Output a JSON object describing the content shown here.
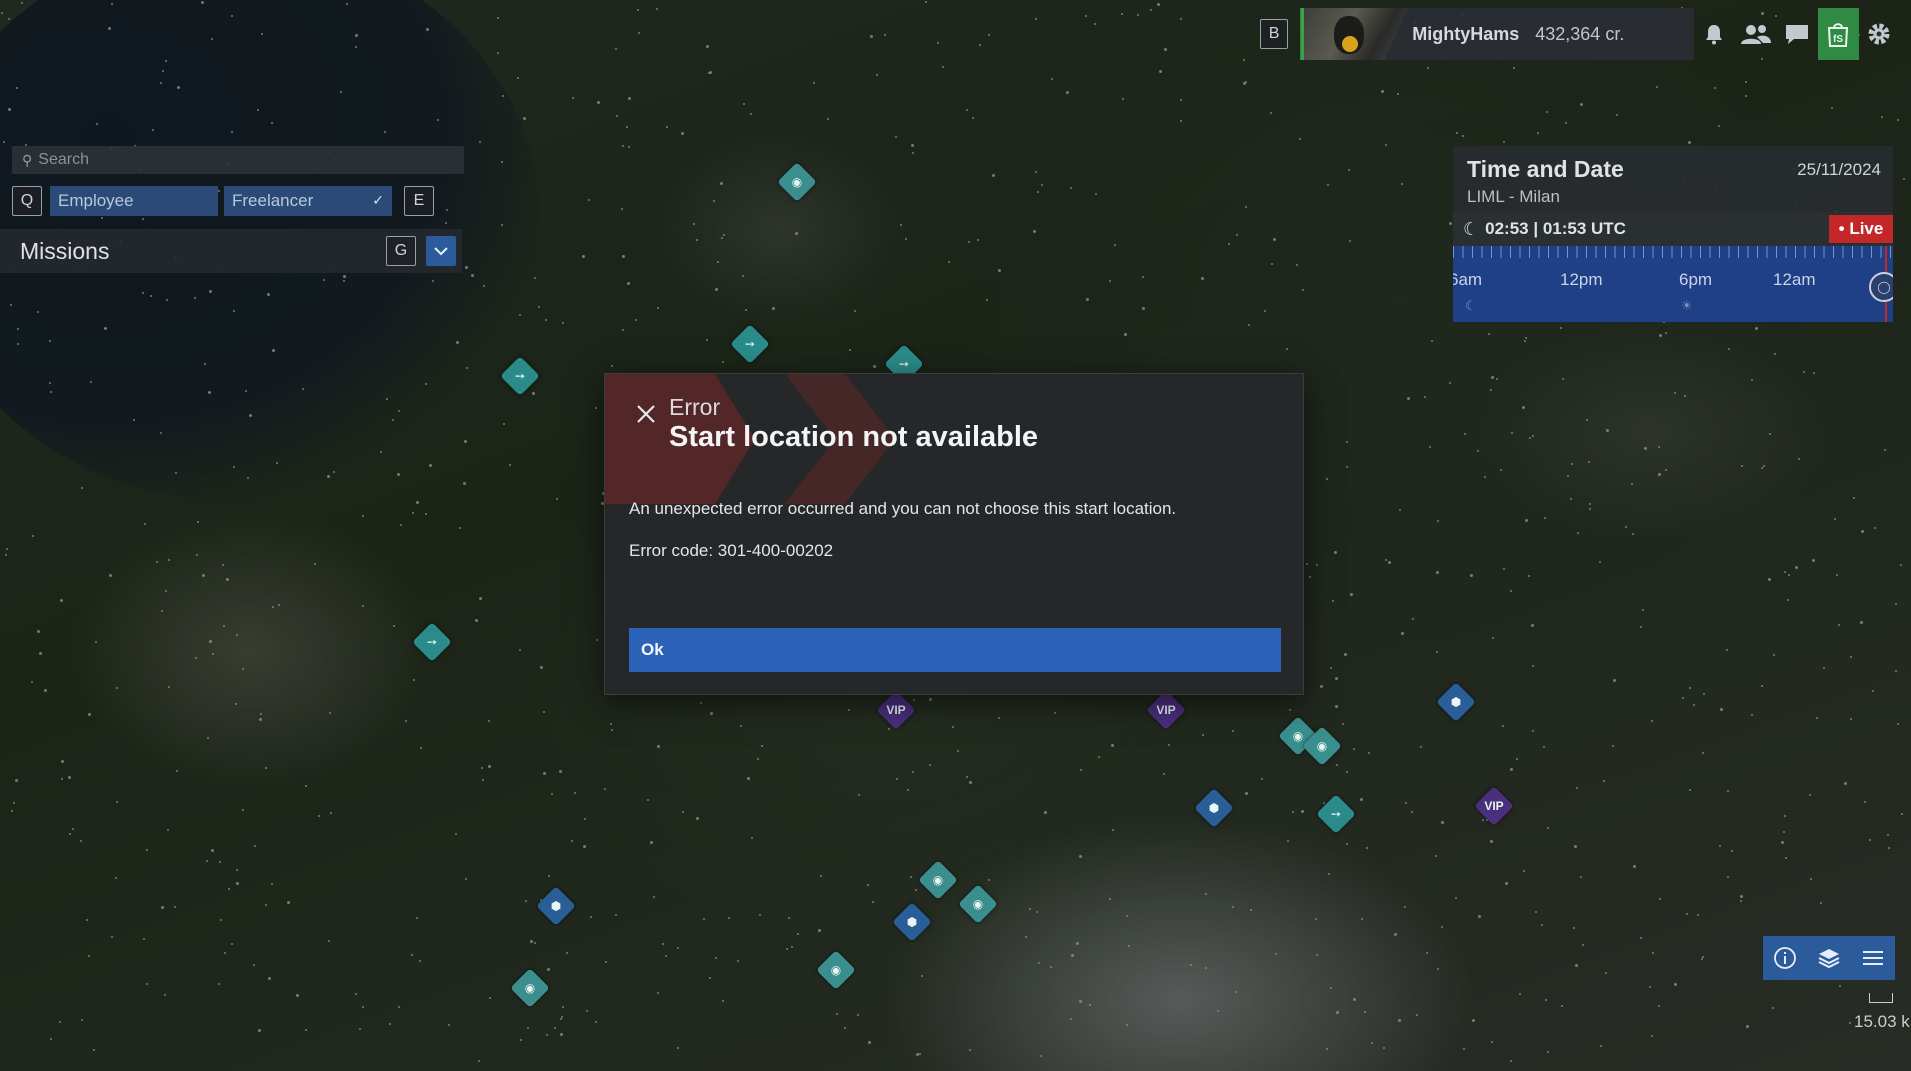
{
  "search": {
    "placeholder": "Search"
  },
  "roles": {
    "prev_key": "Q",
    "next_key": "E",
    "tabs": [
      {
        "label": "Employee",
        "selected": false
      },
      {
        "label": "Freelancer",
        "selected": true
      }
    ]
  },
  "missions": {
    "title": "Missions",
    "toggle_key": "G"
  },
  "topbar": {
    "hotkey": "B",
    "username": "MightyHams",
    "credits": "432,364 cr.",
    "icons": [
      "bell-icon",
      "users-icon",
      "chat-icon",
      "shop-icon",
      "gear-icon"
    ],
    "accent_color": "#2f8a44"
  },
  "time_panel": {
    "title": "Time and Date",
    "date": "25/11/2024",
    "location": "LIML - Milan",
    "current_time": "02:53 | 01:53 UTC",
    "live_label": "• Live",
    "timeline_labels": [
      "6am",
      "12pm",
      "6pm",
      "12am"
    ],
    "live_color": "#c3272a"
  },
  "map": {
    "marker_labels": {
      "vip": "VIP"
    },
    "scale": "15.03 k"
  },
  "dialog": {
    "kicker": "Error",
    "title": "Start location not available",
    "message": "An unexpected error occurred and you can not choose this start location.",
    "code": "Error code: 301-400-00202",
    "ok_label": "Ok",
    "button_color": "#2c63b8"
  }
}
